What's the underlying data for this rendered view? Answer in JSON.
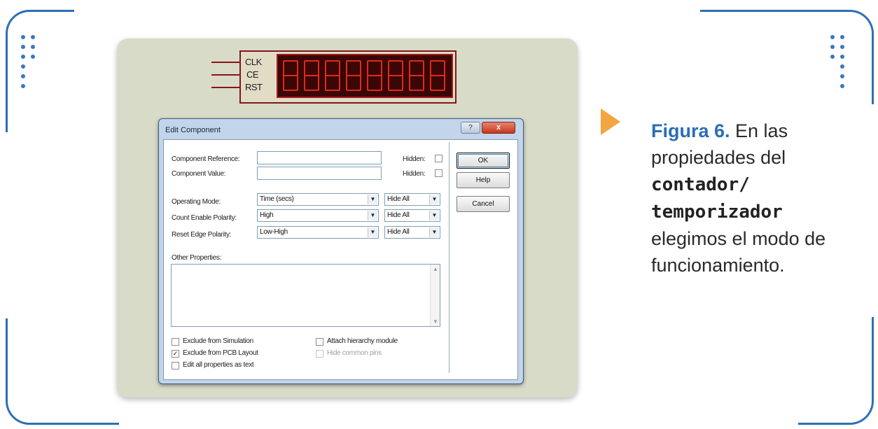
{
  "component": {
    "pins": [
      "CLK",
      "CE",
      "RST"
    ],
    "digit_count": 8,
    "display_color": "#e02a1a"
  },
  "dialog": {
    "title": "Edit Component",
    "title_help_icon": "?",
    "title_close_icon": "x",
    "fields": {
      "component_reference_label": "Component Reference:",
      "component_value_label": "Component Value:",
      "hidden_label": "Hidden:"
    },
    "properties": [
      {
        "label": "Operating Mode:",
        "value": "Time (secs)",
        "visibility": "Hide All"
      },
      {
        "label": "Count Enable Polarity:",
        "value": "High",
        "visibility": "Hide All"
      },
      {
        "label": "Reset Edge Polarity:",
        "value": "Low-High",
        "visibility": "Hide All"
      }
    ],
    "other_properties_label": "Other Properties:",
    "buttons": {
      "ok": "OK",
      "help": "Help",
      "cancel": "Cancel"
    },
    "options": {
      "exclude_simulation": {
        "label": "Exclude from Simulation",
        "checked": false
      },
      "exclude_pcb": {
        "label": "Exclude from PCB Layout",
        "checked": true
      },
      "edit_as_text": {
        "label": "Edit all properties as text",
        "checked": false
      },
      "attach_hierarchy": {
        "label": "Attach hierarchy module",
        "checked": false
      },
      "hide_common_pins": {
        "label": "Hide common pins",
        "checked": false,
        "disabled": true
      }
    }
  },
  "caption": {
    "figure": "Figura 6.",
    "text_1": " En las propiedades del ",
    "mono": "contador/ temporizador",
    "text_2": " elegimos el modo de funcionamiento.",
    "accent": "#2a6fb6",
    "arrow_color": "#f2a541"
  }
}
